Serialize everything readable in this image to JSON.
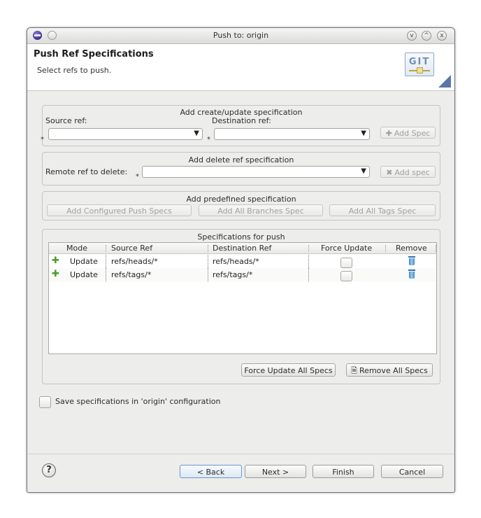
{
  "window": {
    "title": "Push to: origin",
    "buttons": [
      "v",
      "^",
      "x"
    ]
  },
  "header": {
    "title": "Push Ref Specifications",
    "subtitle": "Select refs to push.",
    "badge": "GIT"
  },
  "create_group": {
    "title": "Add create/update specification",
    "source_label": "Source ref:",
    "dest_label": "Destination ref:",
    "source_value": "",
    "dest_value": "",
    "add_button": "Add Spec"
  },
  "delete_group": {
    "title": "Add delete ref specification",
    "remote_label": "Remote ref to delete:",
    "remote_value": "",
    "add_button": "Add spec"
  },
  "predefined_group": {
    "title": "Add predefined specification",
    "buttons": [
      "Add Configured Push Specs",
      "Add All Branches Spec",
      "Add All Tags Spec"
    ]
  },
  "specs_group": {
    "title": "Specifications for push",
    "columns": [
      "Mode",
      "Source Ref",
      "Destination Ref",
      "Force Update",
      "Remove"
    ],
    "rows": [
      {
        "mode": "Update",
        "source": "refs/heads/*",
        "destination": "refs/heads/*",
        "force": false
      },
      {
        "mode": "Update",
        "source": "refs/tags/*",
        "destination": "refs/tags/*",
        "force": false
      }
    ],
    "force_all_button": "Force Update All Specs",
    "remove_all_button": "Remove All Specs"
  },
  "save_config": {
    "label": "Save specifications in 'origin' configuration",
    "checked": false
  },
  "footer": {
    "help": "?",
    "back": "< Back",
    "next": "Next >",
    "finish": "Finish",
    "cancel": "Cancel"
  },
  "required_marker": "*",
  "colors": {
    "accent": "#4c9a2a",
    "trash": "#3d86c6",
    "title_bar": "#dcdcda"
  }
}
